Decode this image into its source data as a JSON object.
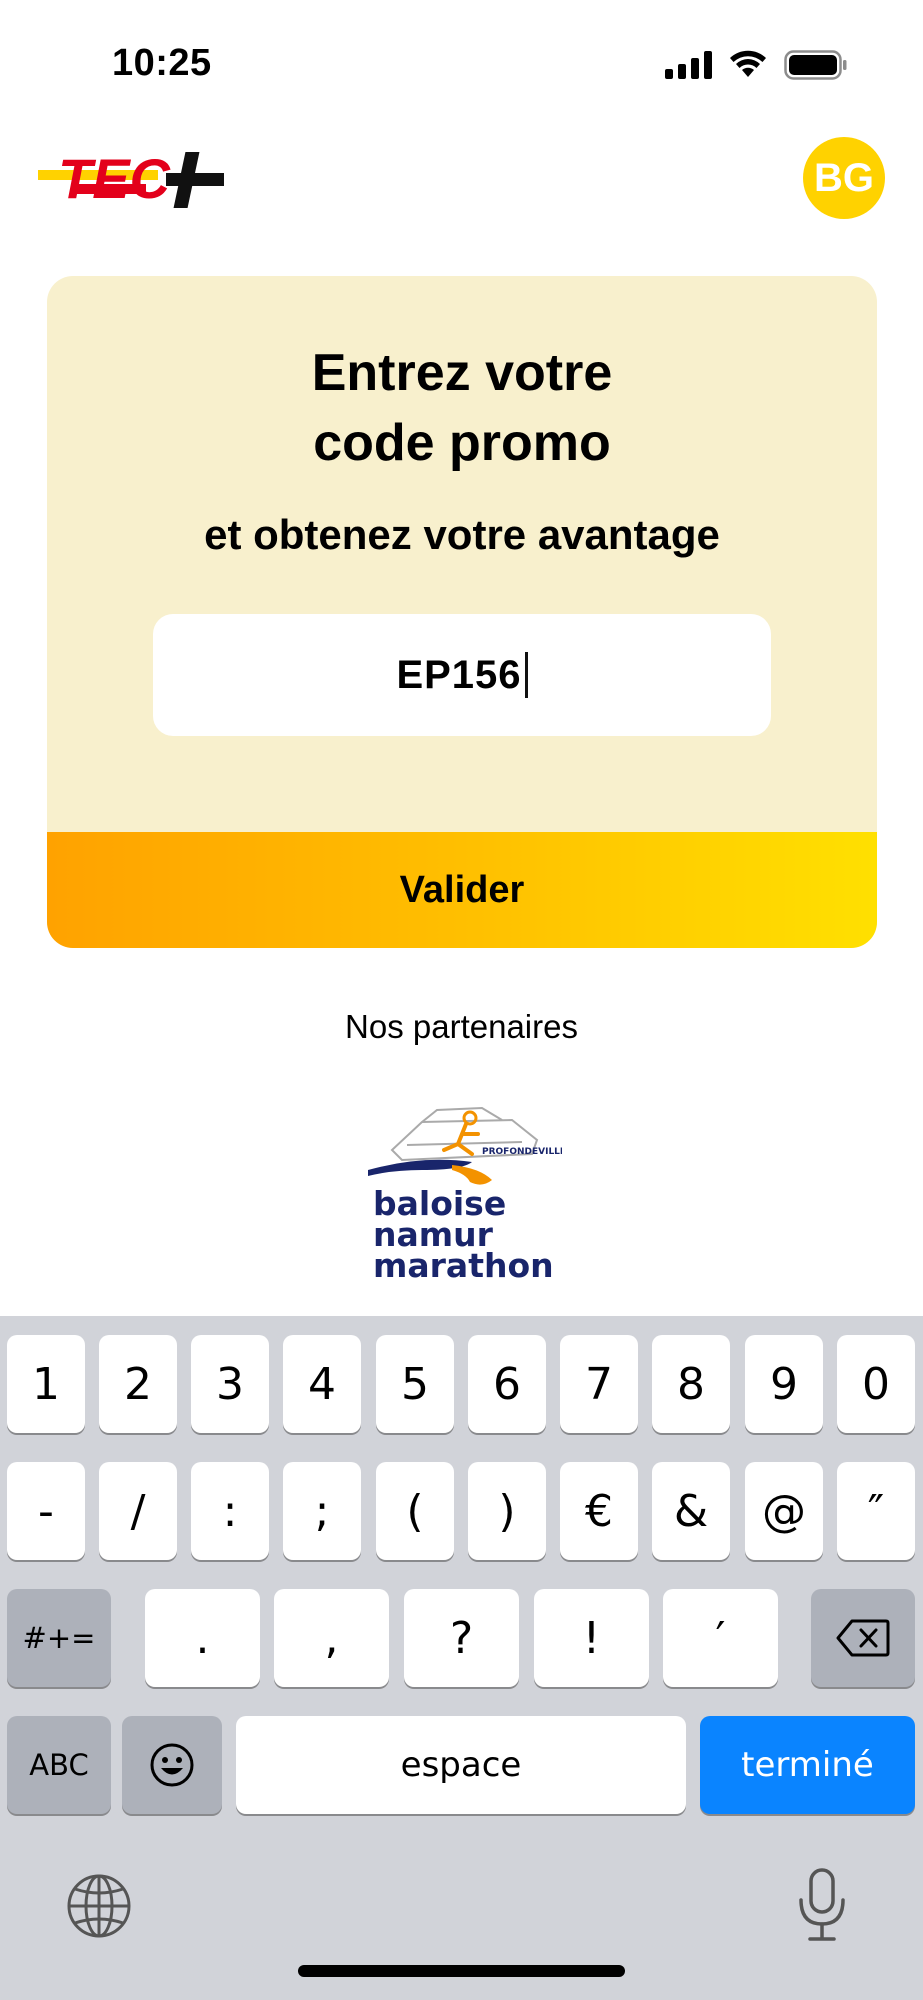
{
  "status": {
    "time": "10:25"
  },
  "header": {
    "logo_text": "TEC+",
    "avatar_initials": "BG"
  },
  "promo": {
    "title_line1": "Entrez votre",
    "title_line2": "code promo",
    "subtitle": "et obtenez votre avantage",
    "code_value": "EP156",
    "validate_label": "Valider"
  },
  "partners": {
    "label": "Nos partenaires",
    "logo_lines": [
      "baloise",
      "namur",
      "marathon"
    ],
    "logo_tag": "PROFONDEVILLE"
  },
  "keyboard": {
    "row1": [
      "1",
      "2",
      "3",
      "4",
      "5",
      "6",
      "7",
      "8",
      "9",
      "0"
    ],
    "row2": [
      "-",
      "/",
      ":",
      ";",
      "(",
      ")",
      "€",
      "&",
      "@",
      "″"
    ],
    "row3_left": "#+=",
    "row3": [
      ".",
      ",",
      "?",
      "!",
      "′"
    ],
    "abc": "ABC",
    "space": "espace",
    "done": "terminé"
  },
  "colors": {
    "accent": "#FFD200",
    "card_bg": "#F8F0CD",
    "done_key": "#0A84FF"
  }
}
